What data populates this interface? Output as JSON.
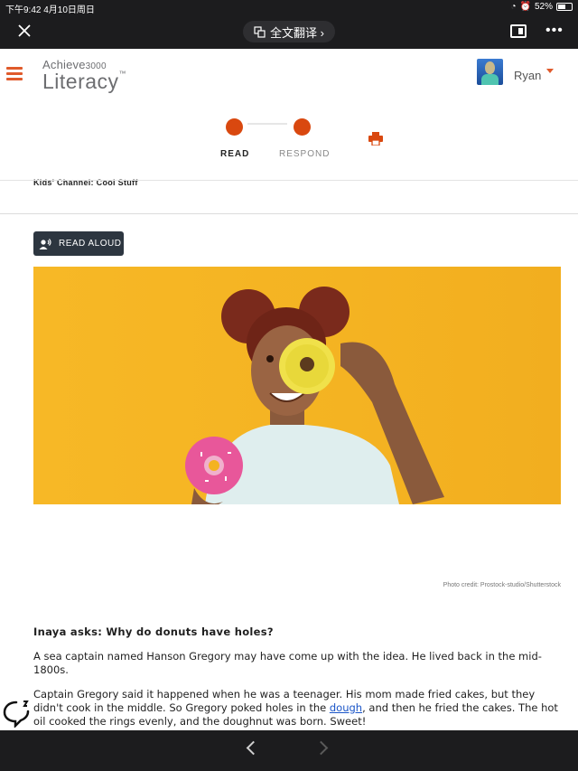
{
  "status": {
    "time_date": "下午9:42  4月10日周日",
    "battery": "52%"
  },
  "browser": {
    "translate_label": "全文翻译 ›"
  },
  "app": {
    "logo_top": "Achieve",
    "logo_num": "3000",
    "logo_bottom": "Literacy",
    "username": "Ryan",
    "accent": "#d9480f"
  },
  "steps": {
    "read": "READ",
    "respond": "RESPOND"
  },
  "article": {
    "section": "Kids' Channel: Cool Stuff",
    "read_aloud": "READ ALOUD",
    "photo_credit": "Photo credit: Prostock-studio/Shutterstock",
    "question": "Inaya asks: Why do donuts have holes?",
    "para1": "A sea captain named Hanson Gregory may have come up with the idea. He lived back in the mid-1800s.",
    "para2_before": "Captain Gregory said it happened when he was a teenager. His mom made fried cakes, but they didn't cook in the middle. So Gregory poked holes in the ",
    "para2_link": "dough",
    "para2_after": ", and then he fried the cakes. The hot oil cooked the rings evenly, and the doughnut was born. Sweet!"
  },
  "icons": [
    "close-icon",
    "translate-icon",
    "reader-mode-icon",
    "more-icon",
    "menu-icon",
    "print-icon",
    "speaker-icon",
    "chat-icon",
    "back-icon",
    "forward-icon"
  ]
}
